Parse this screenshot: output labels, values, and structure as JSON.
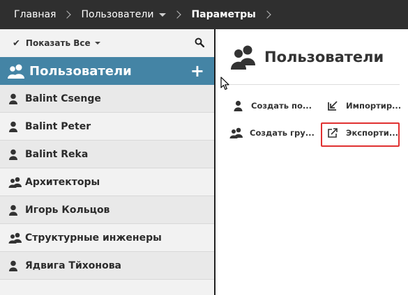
{
  "breadcrumb": {
    "items": [
      "Главная",
      "Пользователи",
      "Параметры"
    ]
  },
  "filter": {
    "label": "Показать Все"
  },
  "group_header": {
    "title": "Пользователи"
  },
  "list": {
    "items": [
      {
        "label": "Balint Csenge",
        "type": "user"
      },
      {
        "label": "Balint Peter",
        "type": "user"
      },
      {
        "label": "Balint Reka",
        "type": "user"
      },
      {
        "label": "Архитекторы",
        "type": "group"
      },
      {
        "label": "Игорь Кольцов",
        "type": "user"
      },
      {
        "label": "Структурные инженеры",
        "type": "group"
      },
      {
        "label": "Ядвига Тйхонова",
        "type": "user"
      }
    ]
  },
  "panel": {
    "title": "Пользователи",
    "actions": {
      "create_user": "Создать по...",
      "import": "Импортир...",
      "create_group": "Создать гру...",
      "export": "Экспорти..."
    }
  },
  "colors": {
    "topbar": "#2f2f2f",
    "accent": "#4484a5",
    "highlight": "#e03030"
  }
}
